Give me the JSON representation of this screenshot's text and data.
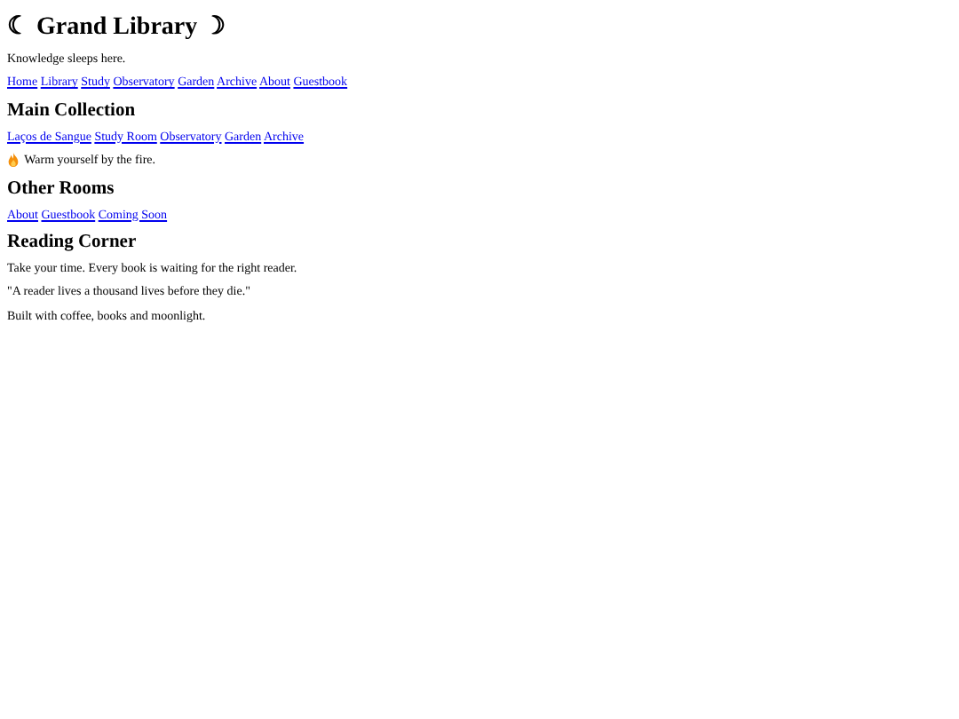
{
  "header": {
    "title": "☾ Grand Library ☽",
    "tagline": "Knowledge sleeps here."
  },
  "nav": [
    "Home",
    "Library",
    "Study",
    "Observatory",
    "Garden",
    "Archive",
    "About",
    "Guestbook"
  ],
  "sections": [
    {
      "heading": "Main Collection",
      "links": [
        "Laços de Sangue",
        "Study Room",
        "Observatory",
        "Garden",
        "Archive"
      ],
      "note": "Warm yourself by the fire."
    },
    {
      "heading": "Other Rooms",
      "links": [
        "About",
        "Guestbook",
        "Coming Soon"
      ]
    },
    {
      "heading": "Reading Corner",
      "paragraphs": [
        "Take your time. Every book is waiting for the right reader.",
        "\"A reader lives a thousand lives before they die.\""
      ]
    }
  ],
  "footer": "Built with coffee, books and moonlight."
}
